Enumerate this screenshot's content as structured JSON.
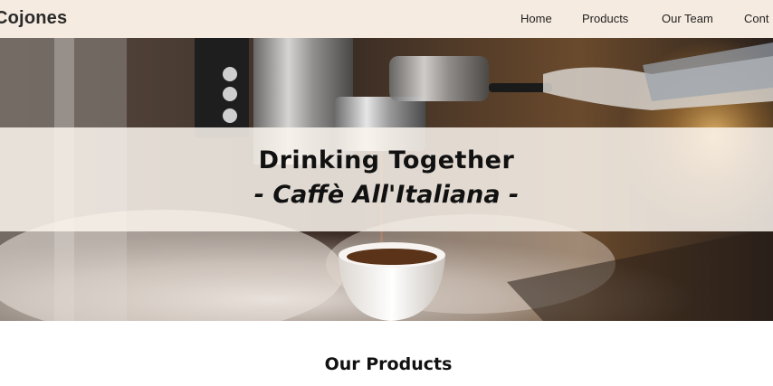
{
  "navbar": {
    "brand": "Cojones",
    "links": {
      "home": "Home",
      "products": "Products",
      "team": "Our Team",
      "contact": "Cont"
    }
  },
  "hero": {
    "title": "Drinking Together",
    "subtitle": "- Caffè All'Italiana -",
    "image": "espresso-machine-photo"
  },
  "products_section": {
    "title": "Our Products"
  }
}
